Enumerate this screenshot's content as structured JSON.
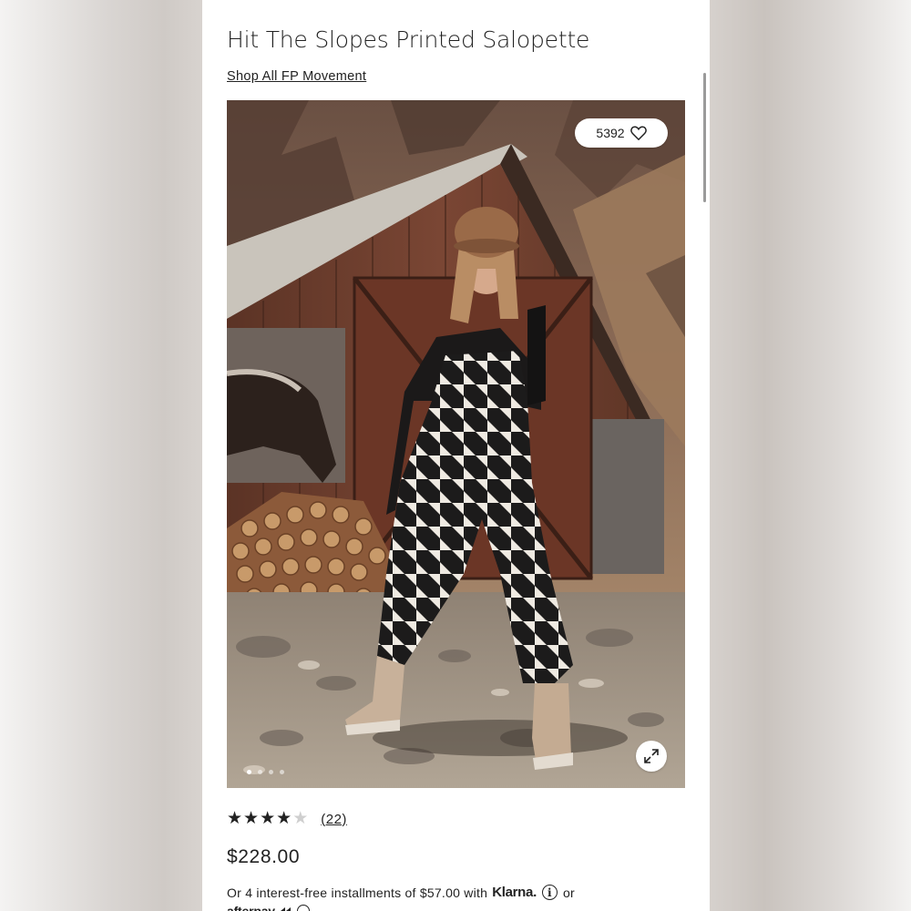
{
  "product": {
    "title": "Hit The Slopes Printed Salopette",
    "shop_link": "Shop All FP Movement",
    "favorites_count": "5392",
    "rating_value": 4,
    "rating_max": 5,
    "review_count": "(22)",
    "price": "$228.00"
  },
  "gallery": {
    "image_count": 4,
    "active_index": 0,
    "icons": {
      "favorite": "heart-icon",
      "expand": "expand-icon"
    }
  },
  "payment": {
    "installment_text": "Or 4 interest-free installments of $57.00 with",
    "klarna_label": "Klarna.",
    "or_label": "or",
    "afterpay_label": "afterpay"
  },
  "colors": {
    "text": "#222222",
    "background": "#ffffff"
  }
}
